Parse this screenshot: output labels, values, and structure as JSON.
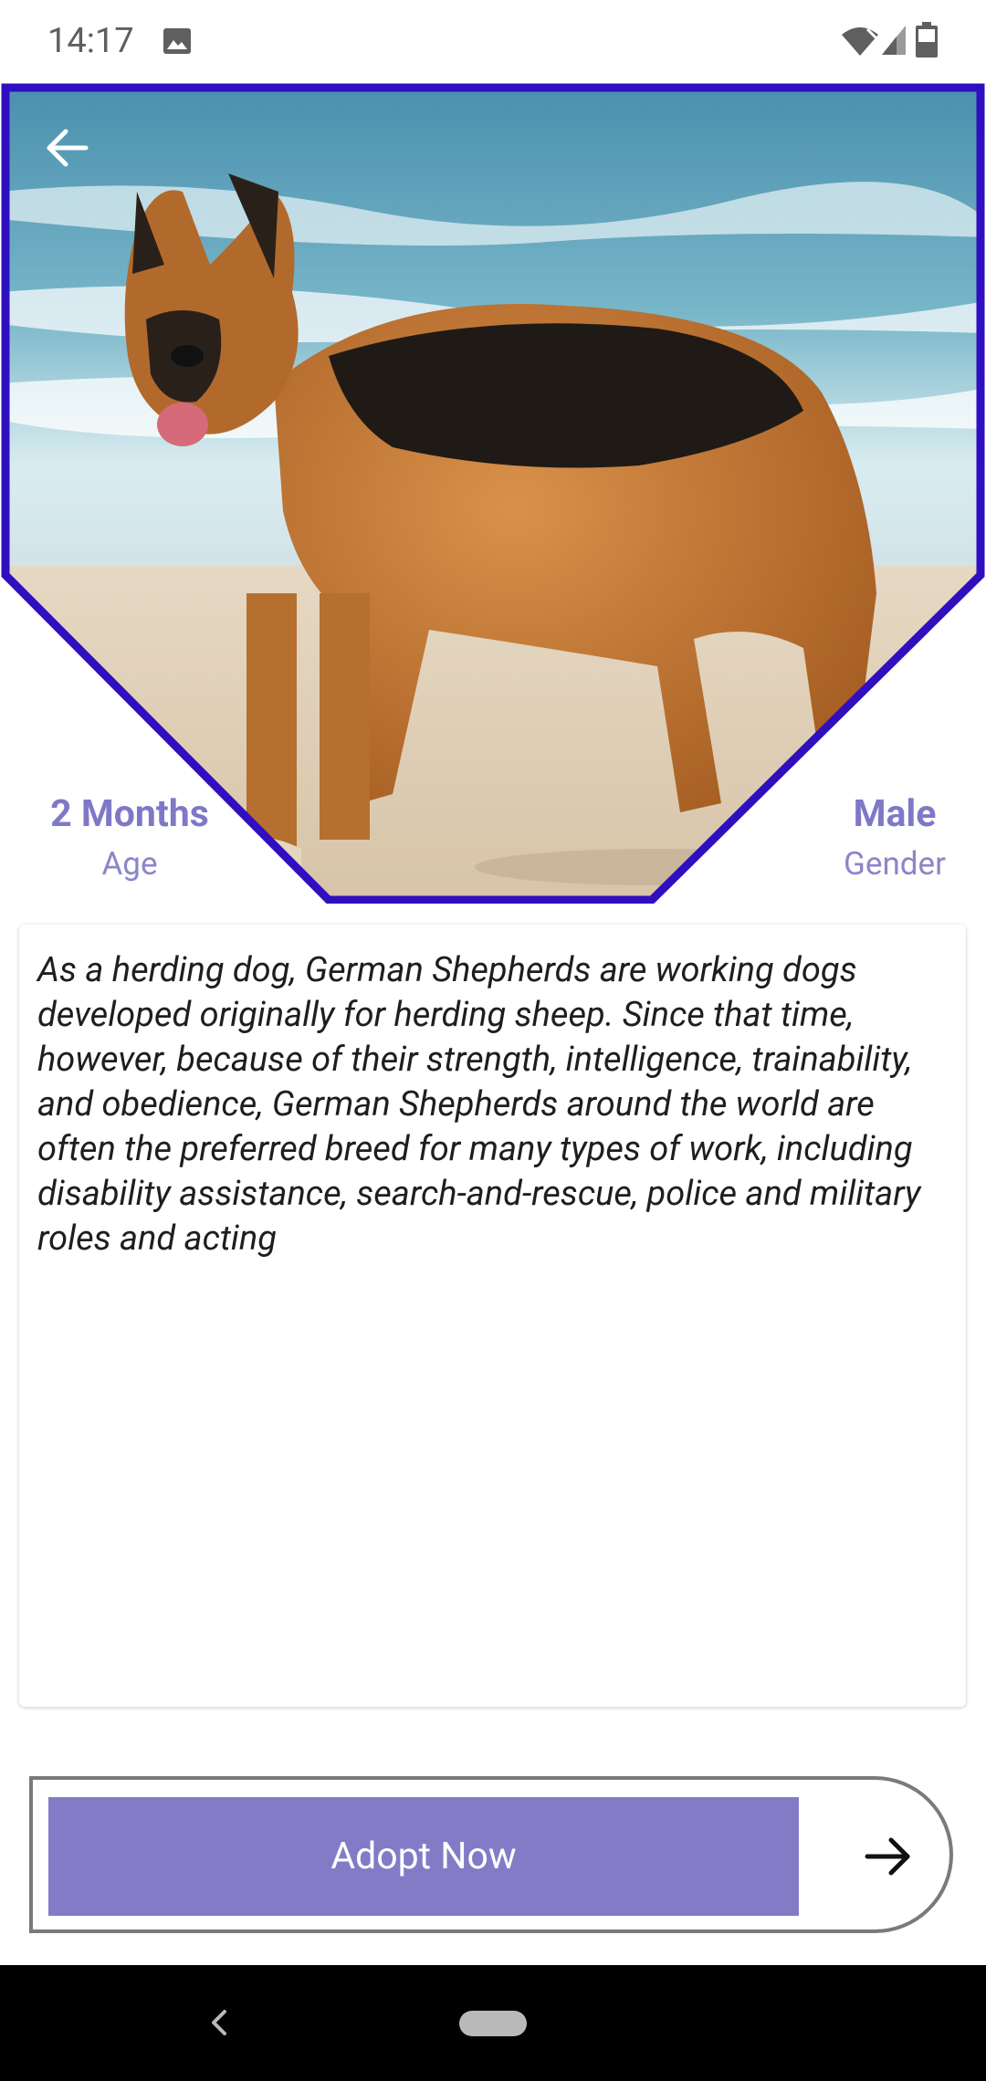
{
  "status_bar": {
    "time": "14:17",
    "icons": [
      "image-icon",
      "wifi-icon",
      "signal-icon",
      "battery-icon"
    ]
  },
  "hero": {
    "image_subject": "german-shepherd-on-beach",
    "frame_color": "#2f0fbf",
    "back_icon": "arrow-left-icon"
  },
  "stats": {
    "age": {
      "value": "2 Months",
      "label": "Age"
    },
    "gender": {
      "value": "Male",
      "label": "Gender"
    }
  },
  "description": {
    "text": "As a herding dog, German Shepherds are working dogs developed originally for herding sheep. Since that time, however, because of their strength, intelligence, trainability, and obedience, German Shepherds around the world are often the preferred breed for many types of work, including disability assistance, search-and-rescue, police and military roles and acting"
  },
  "action": {
    "adopt_label": "Adopt Now",
    "arrow_icon": "arrow-right-icon",
    "button_color": "#837bc6"
  },
  "nav_bar": {
    "back_icon": "chevron-left-icon",
    "home_icon": "home-pill-icon"
  },
  "colors": {
    "accent": "#837bc6",
    "stat_text": "#7f78c7",
    "frame": "#2f0fbf"
  }
}
